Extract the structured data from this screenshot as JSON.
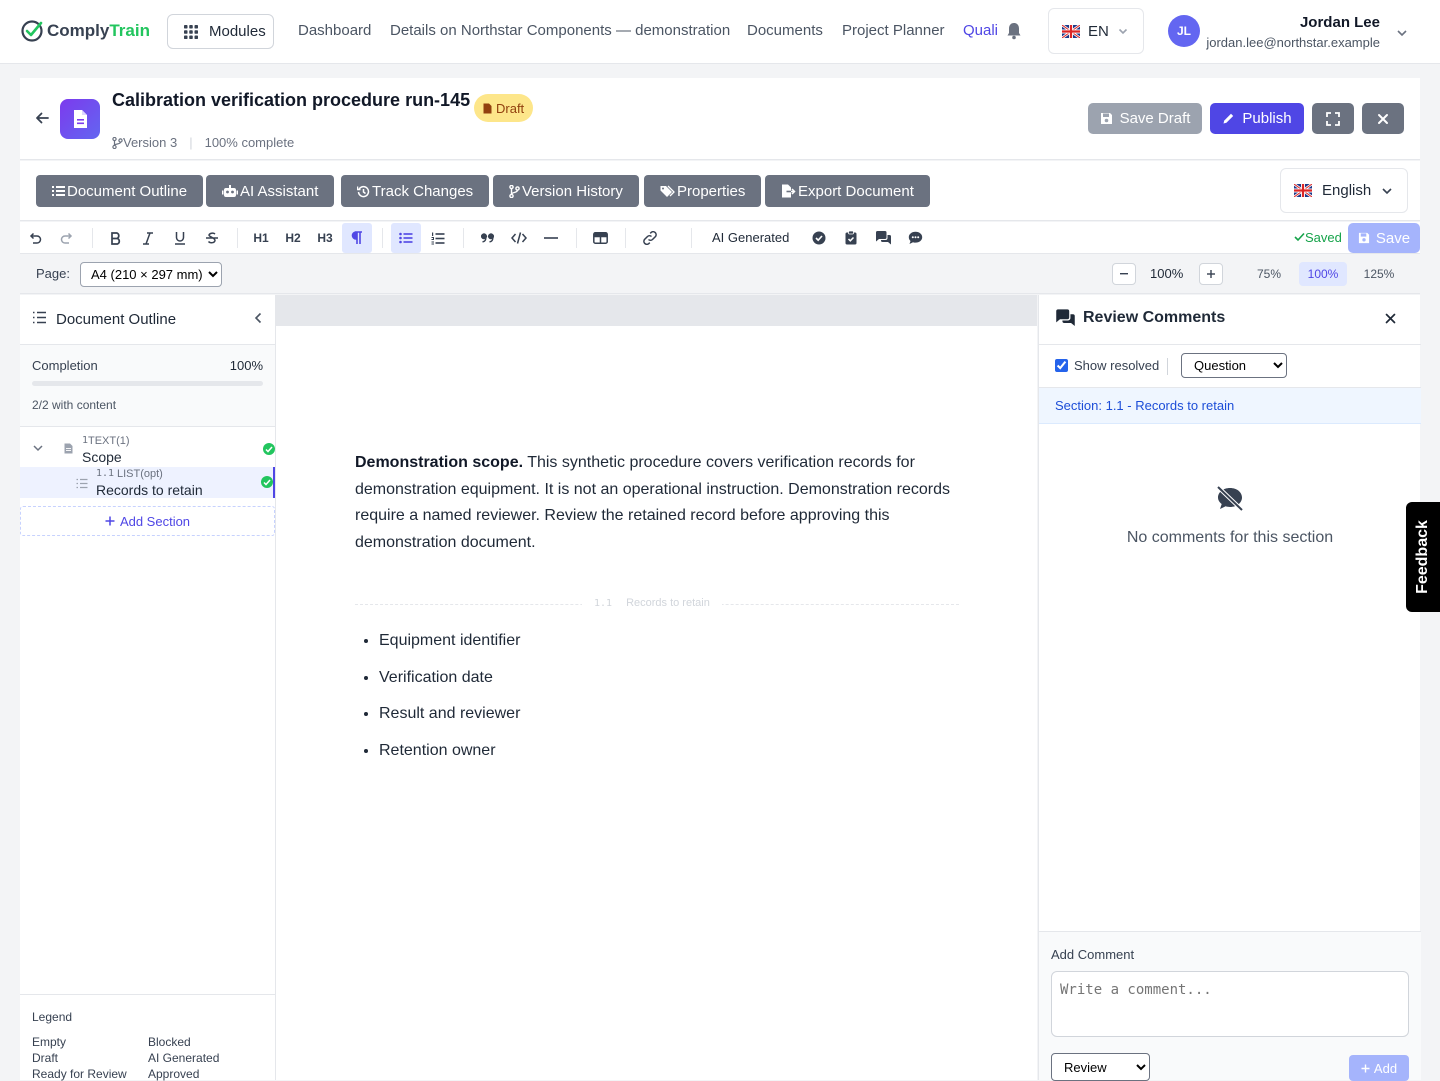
{
  "app": {
    "logo_part1": "Comply",
    "logo_part2": "Train",
    "brand_color": "#22c55e",
    "accent_color": "#4f46e5"
  },
  "topnav": {
    "modules_label": "Modules",
    "links": [
      "Dashboard",
      "Details on Northstar Components — demonstration",
      "Documents",
      "Project Planner",
      "Quali"
    ],
    "active_link": "Quali",
    "language": "EN",
    "user": {
      "initials": "JL",
      "name": "Jordan Lee",
      "email": "jordan.lee@northstar.example"
    }
  },
  "document": {
    "title": "Calibration verification procedure run-145",
    "status_badge": "Draft",
    "version": "Version 3",
    "completion_text": "100% complete",
    "actions": {
      "save_draft": "Save Draft",
      "publish": "Publish"
    }
  },
  "tabs": [
    "Document Outline",
    "AI Assistant",
    "Track Changes",
    "Version History",
    "Properties",
    "Export Document"
  ],
  "content_language": "English",
  "toolbar": {
    "h1": "H1",
    "h2": "H2",
    "h3": "H3",
    "ai_generated_label": "AI Generated",
    "saved_label": "Saved",
    "save_label": "Save"
  },
  "page_settings": {
    "page_label": "Page:",
    "page_size": "A4 (210 × 297 mm)",
    "zoom": "100%",
    "zoom_presets": [
      "75%",
      "100%",
      "125%"
    ],
    "zoom_selected": "100%"
  },
  "outline": {
    "title": "Document Outline",
    "completion_label": "Completion",
    "completion_value": "100%",
    "completion_fraction": 1.0,
    "content_count": "2/2 with content",
    "sections": [
      {
        "num": "1",
        "type": "TEXT(1)",
        "label": "Scope",
        "complete": true
      },
      {
        "num": "1.1",
        "type": "LIST(opt)",
        "label": "Records to retain",
        "complete": true,
        "selected": true
      }
    ],
    "add_section_label": "Add Section",
    "legend_title": "Legend",
    "legend_items": [
      "Empty",
      "Blocked",
      "Draft",
      "AI Generated",
      "Ready for Review",
      "Approved"
    ]
  },
  "editor": {
    "scope_lead": "Demonstration scope.",
    "scope_text": " This synthetic procedure covers verification records for demonstration equipment. It is not an operational instruction. Demonstration records require a named reviewer. Review the retained record before approving this demonstration document.",
    "section_divider_num": "1.1",
    "section_divider_label": "Records to retain",
    "bullets": [
      "Equipment identifier",
      "Verification date",
      "Result and reviewer",
      "Retention owner"
    ]
  },
  "comments": {
    "title": "Review Comments",
    "show_resolved_label": "Show resolved",
    "show_resolved": true,
    "filter_type": "Question",
    "section_label": "Section: 1.1 - Records to retain",
    "empty_text": "No comments for this section",
    "add_label": "Add Comment",
    "placeholder": "Write a comment...",
    "comment_type": "Review",
    "add_button": "Add"
  },
  "feedback_label": "Feedback"
}
